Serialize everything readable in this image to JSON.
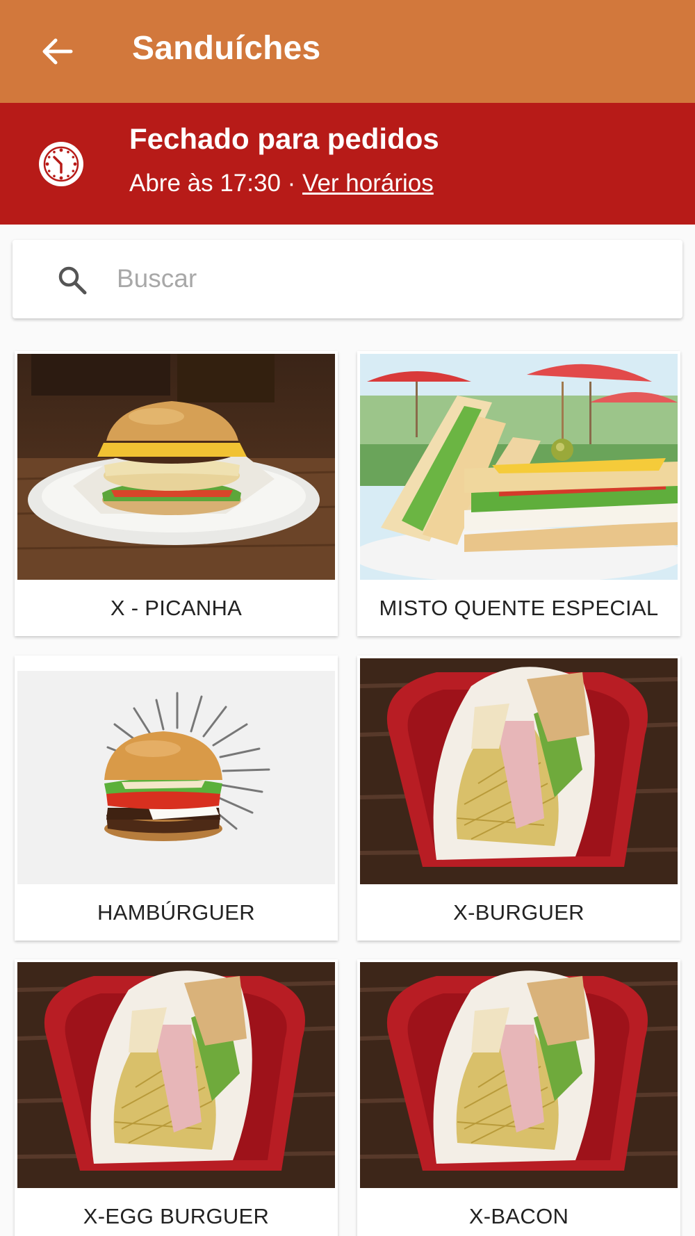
{
  "appbar": {
    "title": "Sanduíches",
    "back_icon": "arrow-left-icon",
    "color": "#d2783c"
  },
  "banner": {
    "title": "Fechado para pedidos",
    "opens_text": "Abre às 17:30 · ",
    "schedule_link": "Ver horários",
    "icon": "clock-icon",
    "color": "#b71b18"
  },
  "search": {
    "placeholder": "Buscar",
    "icon": "search-icon"
  },
  "products": [
    {
      "name": "X - PICANHA",
      "image": "burger-plate-photo"
    },
    {
      "name": "MISTO QUENTE ESPECIAL",
      "image": "club-sandwich-photo"
    },
    {
      "name": "HAMBÚRGUER",
      "image": "burger-illustration-photo"
    },
    {
      "name": "X-BURGUER",
      "image": "wrapped-sandwich-basket-photo"
    },
    {
      "name": "X-EGG BURGUER",
      "image": "wrapped-sandwich-basket-photo"
    },
    {
      "name": "X-BACON",
      "image": "wrapped-sandwich-basket-photo"
    }
  ]
}
